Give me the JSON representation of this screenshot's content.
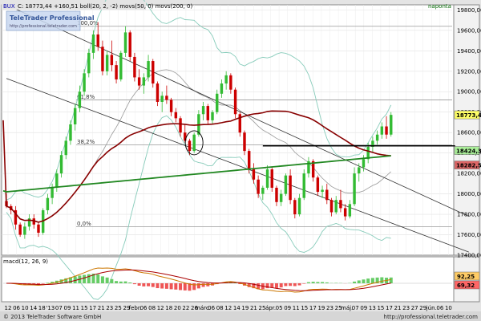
{
  "header": {
    "symbol": "BUX",
    "label": "C: 18773,44  +160,51  boll(20, 2, -2)  movs(50, 0)  movs(200, 0)",
    "interval": "naponta"
  },
  "logo": {
    "brand": "TeleTrader Professional",
    "url": "http://professional.teletrader.com"
  },
  "main_axis": {
    "ticks": [
      "19800,00",
      "19600,00",
      "19400,00",
      "19200,00",
      "19000,00",
      "18800,00",
      "18600,00",
      "18400,00",
      "18200,00",
      "18000,00",
      "17800,00",
      "17600,00",
      "17400,00"
    ],
    "badges": [
      {
        "value": "18773,44",
        "color": "#ffff66"
      },
      {
        "value": "18424,39",
        "color": "#aaee99"
      },
      {
        "value": "18282,51",
        "color": "#dd6666"
      }
    ]
  },
  "fib_labels": [
    "100,0%",
    "61,8%",
    "38,2%",
    "0,0%"
  ],
  "macd": {
    "label": "macd(12, 26, 9)",
    "badges": [
      {
        "value": "92,25",
        "color": "#ffcc66"
      },
      {
        "value": "69,32",
        "color": "#ff6666"
      }
    ]
  },
  "x_axis_labels": [
    "12",
    "06",
    "10",
    "14",
    "18",
    "'13",
    "07",
    "09",
    "11",
    "15",
    "17",
    "21",
    "23",
    "25",
    "29",
    "febr.",
    "06",
    "08",
    "12",
    "18",
    "20",
    "22",
    "26",
    "márc.",
    "06",
    "08",
    "12",
    "14",
    "19",
    "21",
    "25",
    "ápr.",
    "05",
    "09",
    "11",
    "15",
    "17",
    "19",
    "23",
    "25",
    "máj.",
    "07",
    "09",
    "13",
    "15",
    "17",
    "21",
    "23",
    "27",
    "29",
    "jún.",
    "06",
    "10"
  ],
  "footer": {
    "copyright": "© 2013 TeleTrader Software GmbH",
    "url": "http://professional.teletrader.com"
  },
  "chart_data": {
    "type": "candlestick",
    "title": "BUX",
    "ylim": [
      17400,
      19850
    ],
    "grid": true,
    "candles": [
      [
        17930,
        18000,
        17860,
        17880
      ],
      [
        17880,
        17900,
        17800,
        17840
      ],
      [
        17840,
        17880,
        17650,
        17700
      ],
      [
        17700,
        17720,
        17580,
        17600
      ],
      [
        17600,
        17720,
        17560,
        17680
      ],
      [
        17680,
        17800,
        17640,
        17760
      ],
      [
        17760,
        17800,
        17660,
        17700
      ],
      [
        17700,
        17720,
        17580,
        17620
      ],
      [
        17620,
        17860,
        17600,
        17840
      ],
      [
        17840,
        18000,
        17800,
        17960
      ],
      [
        17960,
        18100,
        17900,
        18060
      ],
      [
        18060,
        18240,
        18020,
        18200
      ],
      [
        18200,
        18420,
        18160,
        18380
      ],
      [
        18380,
        18560,
        18340,
        18520
      ],
      [
        18520,
        18720,
        18480,
        18680
      ],
      [
        18680,
        18880,
        18620,
        18840
      ],
      [
        18840,
        19060,
        18800,
        19000
      ],
      [
        19000,
        19220,
        18960,
        19180
      ],
      [
        19180,
        19420,
        19140,
        19380
      ],
      [
        19380,
        19600,
        19320,
        19560
      ],
      [
        19560,
        19680,
        19400,
        19440
      ],
      [
        19440,
        19500,
        19160,
        19200
      ],
      [
        19200,
        19400,
        19160,
        19360
      ],
      [
        19360,
        19500,
        19200,
        19260
      ],
      [
        19260,
        19300,
        19080,
        19120
      ],
      [
        19120,
        19400,
        19100,
        19380
      ],
      [
        19380,
        19640,
        19340,
        19580
      ],
      [
        19580,
        19600,
        19300,
        19340
      ],
      [
        19340,
        19380,
        19100,
        19140
      ],
      [
        19140,
        19220,
        19020,
        19060
      ],
      [
        19060,
        19180,
        18980,
        19140
      ],
      [
        19140,
        19360,
        19100,
        19300
      ],
      [
        19300,
        19320,
        19040,
        19080
      ],
      [
        19080,
        19100,
        18860,
        18900
      ],
      [
        18900,
        19000,
        18800,
        18960
      ],
      [
        18960,
        19060,
        18880,
        18920
      ],
      [
        18920,
        18940,
        18760,
        18800
      ],
      [
        18800,
        18840,
        18700,
        18740
      ],
      [
        18740,
        18760,
        18560,
        18600
      ],
      [
        18600,
        18680,
        18500,
        18520
      ],
      [
        18520,
        18540,
        18380,
        18420
      ],
      [
        18420,
        18600,
        18400,
        18580
      ],
      [
        18580,
        18820,
        18560,
        18780
      ],
      [
        18780,
        18900,
        18720,
        18860
      ],
      [
        18860,
        18880,
        18680,
        18720
      ],
      [
        18720,
        18820,
        18680,
        18800
      ],
      [
        18800,
        19020,
        18780,
        18980
      ],
      [
        18980,
        19120,
        18940,
        19080
      ],
      [
        19080,
        19200,
        19020,
        19160
      ],
      [
        19160,
        19180,
        18980,
        19020
      ],
      [
        19020,
        19040,
        18740,
        18780
      ],
      [
        18780,
        18800,
        18560,
        18600
      ],
      [
        18600,
        18620,
        18380,
        18420
      ],
      [
        18420,
        18440,
        18200,
        18240
      ],
      [
        18240,
        18300,
        18100,
        18140
      ],
      [
        18140,
        18180,
        17960,
        18000
      ],
      [
        18000,
        18080,
        17940,
        18060
      ],
      [
        18060,
        18280,
        18040,
        18240
      ],
      [
        18240,
        18260,
        18020,
        18060
      ],
      [
        18060,
        18080,
        17880,
        17920
      ],
      [
        17920,
        18040,
        17880,
        18000
      ],
      [
        18000,
        18200,
        17980,
        18180
      ],
      [
        18180,
        18240,
        17900,
        17940
      ],
      [
        17940,
        17960,
        17760,
        17800
      ],
      [
        17800,
        18000,
        17780,
        17960
      ],
      [
        17960,
        18240,
        17940,
        18200
      ],
      [
        18200,
        18360,
        18160,
        18320
      ],
      [
        18320,
        18340,
        18120,
        18160
      ],
      [
        18160,
        18180,
        17980,
        18020
      ],
      [
        18020,
        18080,
        17960,
        18040
      ],
      [
        18040,
        18100,
        17900,
        17940
      ],
      [
        17940,
        17960,
        17780,
        17820
      ],
      [
        17820,
        17980,
        17800,
        17940
      ],
      [
        17940,
        18040,
        17820,
        17860
      ],
      [
        17860,
        17900,
        17740,
        17780
      ],
      [
        17780,
        17940,
        17760,
        17900
      ],
      [
        17900,
        18260,
        17880,
        18200
      ],
      [
        18200,
        18300,
        18120,
        18260
      ],
      [
        18260,
        18380,
        18220,
        18340
      ],
      [
        18340,
        18500,
        18300,
        18460
      ],
      [
        18460,
        18560,
        18400,
        18520
      ],
      [
        18520,
        18620,
        18480,
        18580
      ],
      [
        18580,
        18700,
        18540,
        18660
      ],
      [
        18660,
        18760,
        18540,
        18580
      ],
      [
        18580,
        18800,
        18560,
        18773
      ]
    ],
    "fibonacci": {
      "100%": 19640,
      "61.8%": 18920,
      "38.2%": 18480,
      "0%": 17680
    },
    "support_level": 18470,
    "channel": {
      "upper": [
        [
          0,
          19850
        ],
        [
          101,
          17780
        ]
      ],
      "lower": [
        [
          0,
          19130
        ],
        [
          101,
          17430
        ]
      ]
    }
  }
}
